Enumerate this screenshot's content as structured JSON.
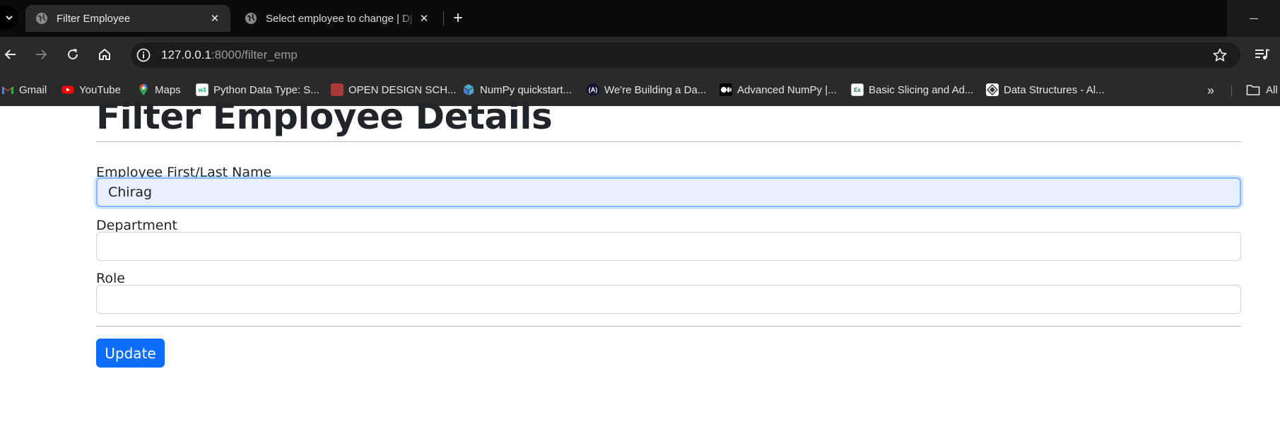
{
  "browser": {
    "tabs": [
      {
        "title": "Filter Employee",
        "active": true
      },
      {
        "title": "Select employee to change | Dj",
        "active": false
      }
    ],
    "url_host": "127.0.0.1",
    "url_path": ":8000/filter_emp",
    "bookmarks": [
      {
        "label": "Gmail",
        "icon": "gmail-icon"
      },
      {
        "label": "YouTube",
        "icon": "youtube-icon"
      },
      {
        "label": "Maps",
        "icon": "maps-icon"
      },
      {
        "label": "Python Data Type: S...",
        "icon": "w3schools-icon"
      },
      {
        "label": "OPEN DESIGN SCH...",
        "icon": "open-design-icon"
      },
      {
        "label": "NumPy quickstart...",
        "icon": "numpy-icon"
      },
      {
        "label": "We're Building a Da...",
        "icon": "code-icon"
      },
      {
        "label": "Advanced NumPy |...",
        "icon": "medium-icon"
      },
      {
        "label": "Basic Slicing and Ad...",
        "icon": "excel-icon"
      },
      {
        "label": "Data Structures - Al...",
        "icon": "diamond-icon"
      }
    ],
    "all_bookmarks_label": "All"
  },
  "page": {
    "heading": "Filter Employee Details",
    "fields": [
      {
        "label": "Employee First/Last Name",
        "value": "Chirag"
      },
      {
        "label": "Department",
        "value": ""
      },
      {
        "label": "Role",
        "value": ""
      }
    ],
    "submit_label": "Update"
  },
  "colors": {
    "primary": "#0d6efd",
    "autofill": "#e8f0fe",
    "chrome_dark": "#2a2a2a"
  }
}
